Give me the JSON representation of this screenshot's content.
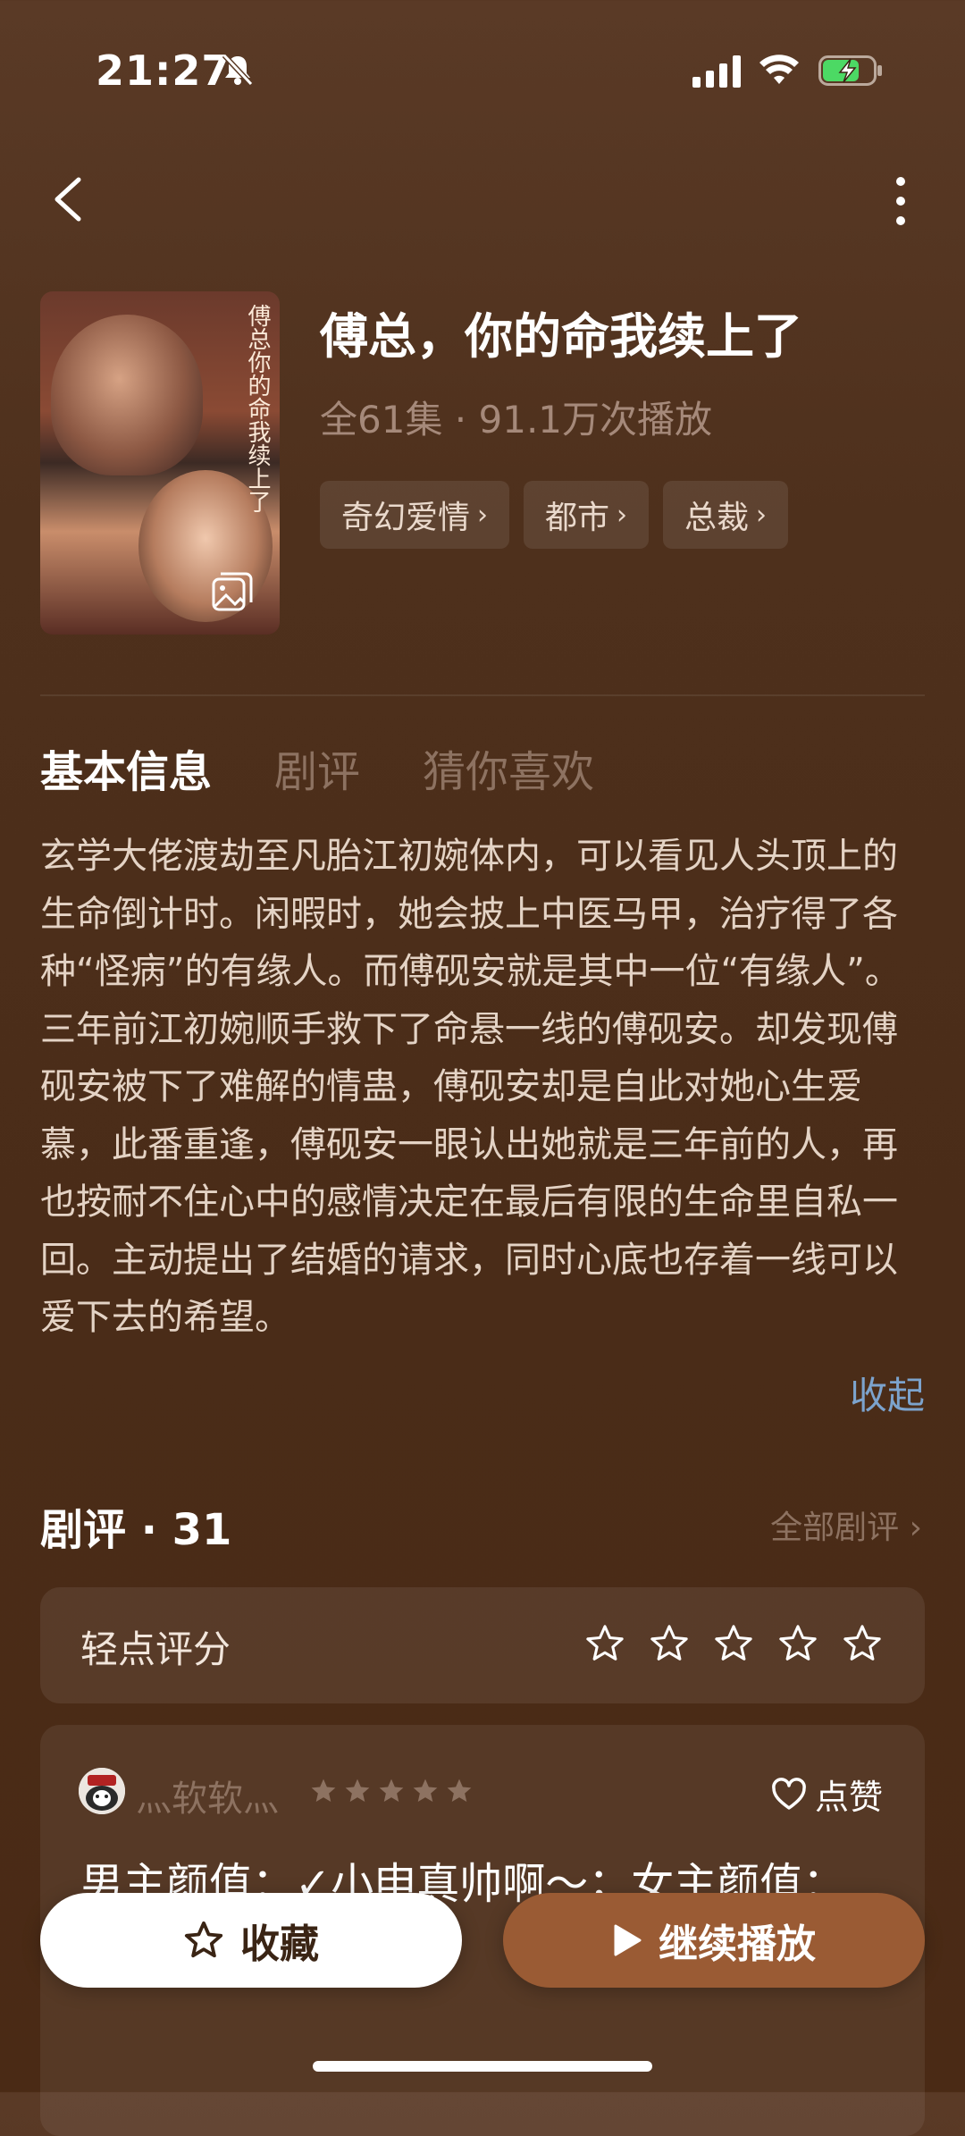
{
  "status_bar": {
    "time": "21:27",
    "icons": [
      "bell-slash-icon",
      "signal-icon",
      "wifi-icon",
      "battery-charging-icon"
    ]
  },
  "nav": {
    "back_icon": "chevron-left-icon",
    "more_icon": "more-vertical-icon"
  },
  "show": {
    "cover_text": "傅总你的命我续上了",
    "cover_badge_icon": "gallery-icon",
    "title": "傅总，你的命我续上了",
    "meta": "全61集 · 91.1万次播放",
    "tags": [
      "奇幻爱情",
      "都市",
      "总裁"
    ]
  },
  "tabs": [
    "基本信息",
    "剧评",
    "猜你喜欢"
  ],
  "description": "玄学大佬渡劫至凡胎江初婉体内，可以看见人头顶上的生命倒计时。闲暇时，她会披上中医马甲，治疗得了各种“怪病”的有缘人。而傅砚安就是其中一位“有缘人”。三年前江初婉顺手救下了命悬一线的傅砚安。却发现傅砚安被下了难解的情蛊，傅砚安却是自此对她心生爱慕，此番重逢，傅砚安一眼认出她就是三年前的人，再也按耐不住心中的感情决定在最后有限的生命里自私一回。主动提出了结婚的请求，同时心底也存着一线可以爱下去的希望。",
  "collapse_label": "收起",
  "reviews": {
    "title": "剧评 · 31",
    "all_label": "全部剧评",
    "rating_label": "轻点评分",
    "rating_stars": 5,
    "items": [
      {
        "user": "灬软软灬",
        "stars": 5,
        "like_label": "点赞",
        "text": "男主颜值：✓小申真帅啊～；女主颜值："
      }
    ]
  },
  "bottom_bar": {
    "favorite_label": "收藏",
    "play_label": "继续播放"
  },
  "colors": {
    "accent_play": "#9a5b34",
    "link": "#7ca3cd",
    "background": "#4e301c"
  }
}
